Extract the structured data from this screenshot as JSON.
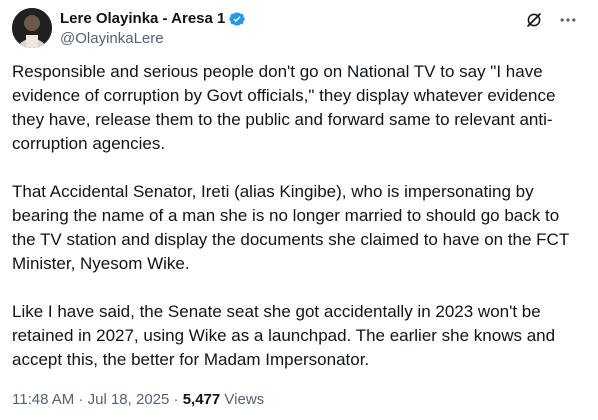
{
  "author": {
    "display_name": "Lere Olayinka - Aresa 1",
    "handle": "@OlayinkaLere",
    "verified": true,
    "verified_color": "#1d9bf0"
  },
  "header_icons": {
    "grok": "grok-icon",
    "more": "more-options-icon"
  },
  "tweet": {
    "paragraphs": [
      "Responsible and serious people don't go on National TV to say \"I have evidence of corruption by Govt officials,\" they display whatever evidence they have, release them to the public and forward same to relevant anti-corruption agencies.",
      "That Accidental Senator, Ireti (alias Kingibe), who is impersonating by bearing the name of a man she is no longer married to should go back to the TV station and display the documents she claimed to have on the FCT Minister,  Nyesom Wike.",
      "Like I have said, the Senate seat she got accidentally in 2023 won't be retained in 2027, using Wike as a launchpad. The earlier she knows and accept this, the better for Madam Impersonator."
    ]
  },
  "meta": {
    "time": "11:48 AM",
    "separator": "·",
    "date": "Jul 18, 2025",
    "separator2": "·",
    "views_count": "5,477",
    "views_label": "Views"
  },
  "colors": {
    "text": "#0f1419",
    "secondary": "#536471",
    "accent": "#1d9bf0"
  }
}
